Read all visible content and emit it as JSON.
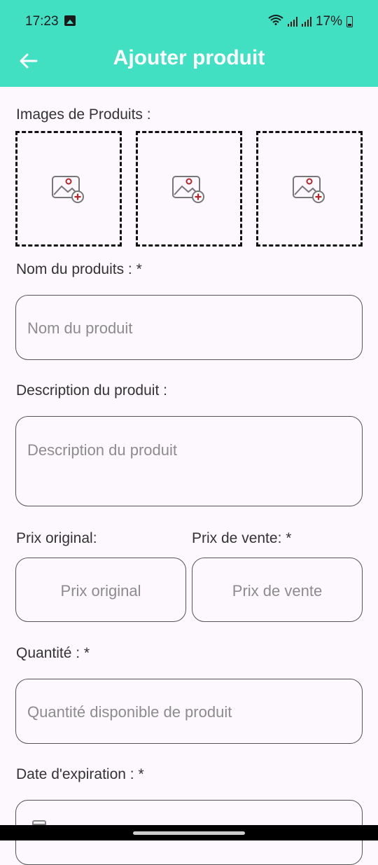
{
  "status": {
    "time": "17:23",
    "battery": "17%"
  },
  "appbar": {
    "title": "Ajouter produit"
  },
  "images": {
    "label": "Images de Produits :",
    "slots": 3
  },
  "name": {
    "label": "Nom du produits : *",
    "placeholder": "Nom du produit"
  },
  "description": {
    "label": "Description du produit :",
    "placeholder": "Description du produit"
  },
  "price_original": {
    "label": "Prix original:",
    "placeholder": "Prix original"
  },
  "price_sale": {
    "label": "Prix de vente: *",
    "placeholder": "Prix de vente"
  },
  "quantity": {
    "label": "Quantité : *",
    "placeholder": "Quantité disponible de produit"
  },
  "expiration": {
    "label": "Date d'expiration : *"
  },
  "colors": {
    "accent": "#42e0c3",
    "icon_red": "#b3262d"
  }
}
